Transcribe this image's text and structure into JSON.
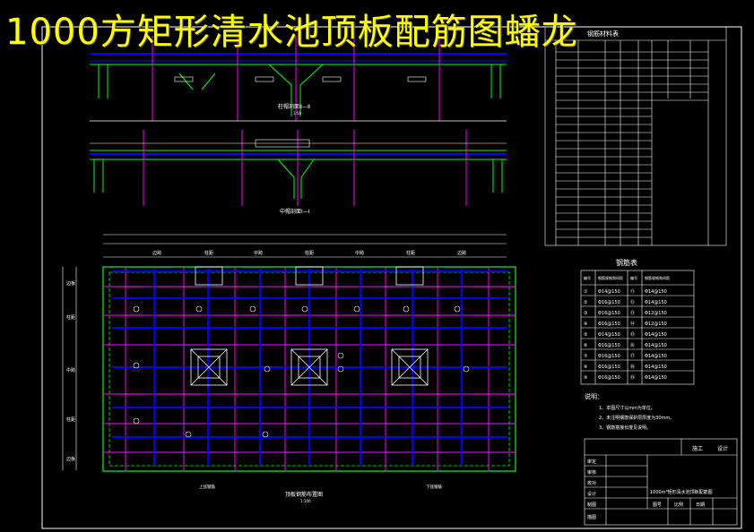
{
  "title": "1000方矩形清水池顶板配筋图蟠龙",
  "colors": {
    "background": "#000000",
    "title": "#ffff00",
    "frame": "#ffffff",
    "grid": "#ff00ff",
    "rebar": "#0000ff",
    "wall": "#00ff00",
    "text": "#ffffff",
    "dim": "#ffff00"
  },
  "sections": {
    "section_2": "柱帽剖面Ⅱ—Ⅱ",
    "section_1": "中帽剖面Ⅰ—Ⅰ",
    "scale": "1:50"
  },
  "plan": {
    "title": "顶板钢筋布置图",
    "scale": "1:100",
    "left_note": "上弦钢筋",
    "right_note": "下弦钢筋",
    "top_labels": [
      "边跨",
      "柱距",
      "中跨",
      "柱距",
      "中跨",
      "柱距",
      "边跨"
    ],
    "left_labels": [
      "边板",
      "柱距",
      "中跨",
      "柱距",
      "边板"
    ]
  },
  "rebar_schedule": {
    "title": "钢筋材料表"
  },
  "rebar_table": {
    "title": "钢筋表",
    "headers": [
      "编号",
      "钢筋规格和间距",
      "编号",
      "钢筋规格和间距"
    ],
    "rows": [
      [
        "①",
        "Φ14@150",
        "⑪",
        "Φ14@150"
      ],
      [
        "②",
        "Φ16@150",
        "⑫",
        "Φ14@150"
      ],
      [
        "③",
        "Φ16@150",
        "⑬",
        "Φ12@150"
      ],
      [
        "④",
        "Φ16@150",
        "⑭",
        "Φ12@150"
      ],
      [
        "⑤",
        "Φ14@150",
        "⑮",
        "Φ14@150"
      ],
      [
        "⑥",
        "Φ16@150",
        "⑯",
        "Φ14@150"
      ],
      [
        "⑦",
        "Φ16@150",
        "⑰",
        "Φ14@150"
      ],
      [
        "⑧",
        "Φ16@150",
        "⑱",
        "Φ14@150"
      ],
      [
        "⑨",
        "Φ16@150",
        "⑲",
        "Φ14@150"
      ]
    ]
  },
  "notes": {
    "heading": "说明：",
    "items": [
      "1、本图尺寸以mm为单位。",
      "2、未注明钢筋保护层厚度为30mm。",
      "3、钢筋搭接长度见说明。"
    ]
  },
  "title_block": {
    "design_phase": "施工",
    "drawing_type": "设计",
    "rows": [
      "审定",
      "审核",
      "校对",
      "设计",
      "制图",
      "描图"
    ],
    "drawing_name": "1000m³矩形清水池顶板配筋图",
    "sheet_label": "图号",
    "scale_label": "比例",
    "date_label": "日期"
  }
}
